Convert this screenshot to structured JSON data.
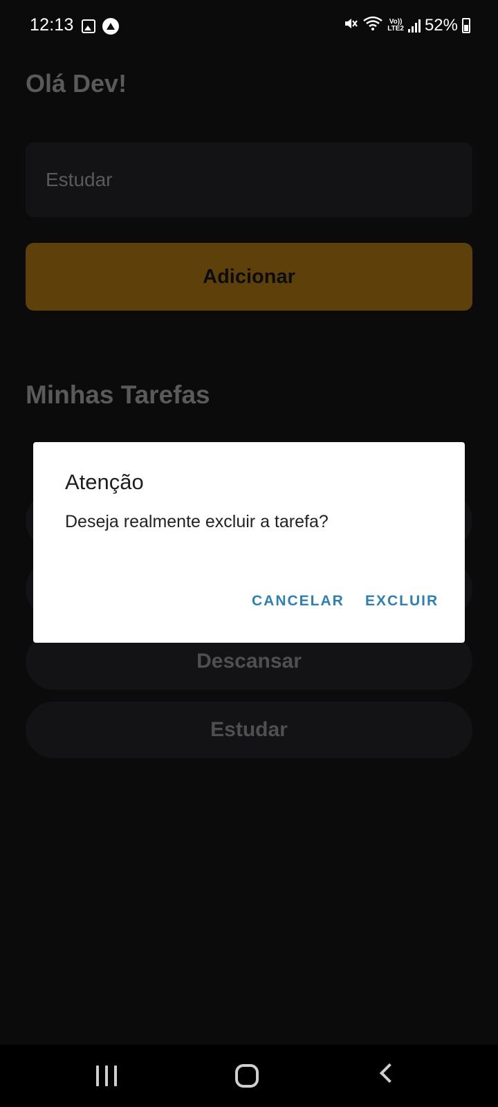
{
  "status_bar": {
    "time": "12:13",
    "volte_top": "Vo))",
    "volte_bottom": "LTE2",
    "battery_percent": "52%"
  },
  "header": {
    "greeting": "Olá Dev!"
  },
  "form": {
    "input_placeholder": "Estudar",
    "add_button_label": "Adicionar"
  },
  "tasks": {
    "title": "Minhas Tarefas",
    "items": [
      "",
      "",
      "Descansar",
      "Estudar"
    ]
  },
  "dialog": {
    "title": "Atenção",
    "message": "Deseja realmente excluir a tarefa?",
    "cancel_label": "CANCELAR",
    "confirm_label": "EXCLUIR"
  },
  "colors": {
    "background": "#0b0b0c",
    "accent_dimmed": "#5e400b",
    "dialog_button": "#2f7fb3"
  },
  "icons": [
    "gallery-icon",
    "expo-icon",
    "mute-icon",
    "wifi-icon",
    "signal-icon",
    "battery-icon",
    "recent-apps-icon",
    "home-icon",
    "back-icon"
  ]
}
